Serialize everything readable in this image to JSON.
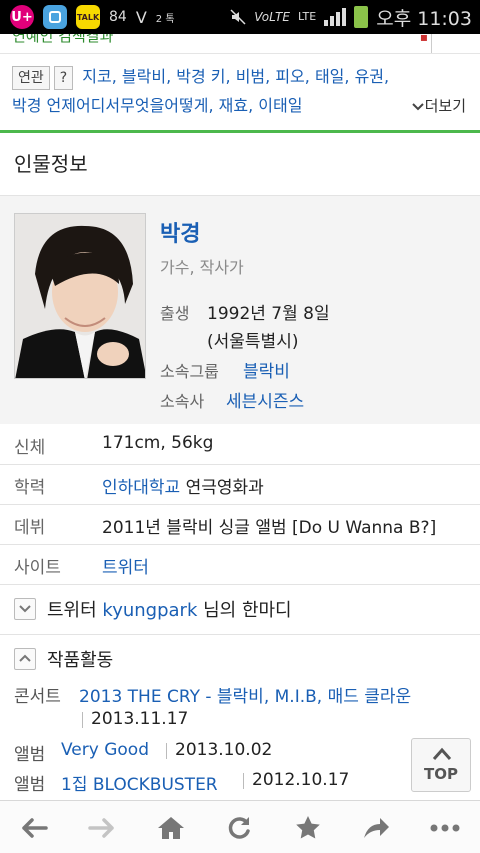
{
  "status_bar": {
    "uplus": "U+",
    "talk": "TALK",
    "count": "84",
    "v_glyph": "V",
    "small": "2 톡",
    "volte": "VoLTE",
    "lte": "LTE",
    "clock": "오후 11:03"
  },
  "top_strip": {
    "cut_text": "연예인 검색결과"
  },
  "related": {
    "tag_label": "연관",
    "help_label": "?",
    "line1_links": [
      "지코",
      "블락비",
      "박경 키",
      "비범",
      "피오",
      "태일",
      "유권"
    ],
    "line2_links": [
      "박경 언제어디서무엇을어떻게",
      "재효",
      "이태일"
    ],
    "more_label": "더보기"
  },
  "section": {
    "title": "인물정보"
  },
  "profile": {
    "name": "박경",
    "job": "가수, 작사가",
    "birth_label": "출생",
    "birth_date": "1992년 7월 8일",
    "birth_place": "(서울특별시)",
    "group_label": "소속그룹",
    "group_value": "블락비",
    "agency_label": "소속사",
    "agency_value": "세븐시즌스"
  },
  "info_rows": {
    "body_label": "신체",
    "body_value": "171cm, 56kg",
    "edu_label": "학력",
    "edu_school": "인하대학교",
    "edu_major": " 연극영화과",
    "debut_label": "데뷔",
    "debut_value": "2011년 블락비 싱글 앨범 [Do U Wanna B?]",
    "site_label": "사이트",
    "site_value": "트위터"
  },
  "tweet": {
    "prefix": "트위터 ",
    "handle": "kyungpark",
    "suffix": " 님의 한마디"
  },
  "works": {
    "title": "작품활동",
    "items": [
      {
        "type": "콘서트",
        "title": "2013 THE CRY - 블락비, M.I.B, 매드 클라운",
        "date": "2013.11.17"
      },
      {
        "type": "앨범",
        "title": "Very Good",
        "date": "2013.10.02"
      },
      {
        "type": "앨범",
        "title": "1집 BLOCKBUSTER",
        "date": "2012.10.17"
      }
    ]
  },
  "top_button": {
    "label": "TOP"
  },
  "bottom_nav": {
    "icons": [
      "back-icon",
      "forward-icon",
      "home-icon",
      "refresh-icon",
      "bookmark-star-icon",
      "share-icon",
      "more-icon"
    ]
  }
}
